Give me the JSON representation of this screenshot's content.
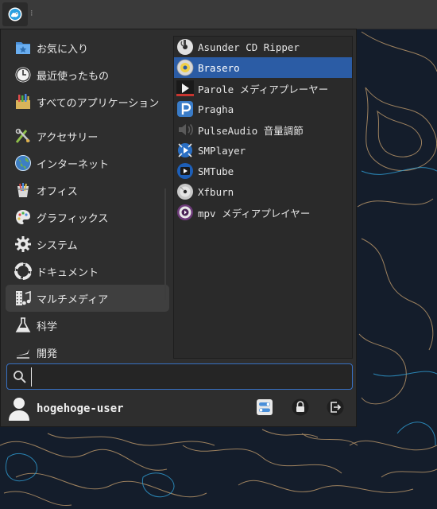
{
  "panel": {
    "menu_button_icon": "xfce-logo-icon",
    "separator": "⁝"
  },
  "categories": [
    {
      "label": "お気に入り",
      "icon": "favorites-icon"
    },
    {
      "label": "最近使ったもの",
      "icon": "clock-icon"
    },
    {
      "label": "すべてのアプリケーション",
      "icon": "all-applications-icon"
    },
    {
      "label": "アクセサリー",
      "icon": "accessories-icon"
    },
    {
      "label": "インターネット",
      "icon": "globe-icon"
    },
    {
      "label": "オフィス",
      "icon": "office-icon"
    },
    {
      "label": "グラフィックス",
      "icon": "palette-icon"
    },
    {
      "label": "システム",
      "icon": "gear-icon"
    },
    {
      "label": "ドキュメント",
      "icon": "lifebuoy-icon"
    },
    {
      "label": "マルチメディア",
      "icon": "multimedia-icon",
      "active": true
    },
    {
      "label": "科学",
      "icon": "flask-icon"
    },
    {
      "label": "開発",
      "icon": "development-icon"
    }
  ],
  "apps": [
    {
      "label": "Asunder CD Ripper",
      "icon": "cd-icon"
    },
    {
      "label": "Brasero",
      "icon": "disc-burner-icon",
      "selected": true
    },
    {
      "label": "Parole メディアプレーヤー",
      "icon": "media-player-icon"
    },
    {
      "label": "Pragha",
      "icon": "music-player-icon"
    },
    {
      "label": "PulseAudio 音量調節",
      "icon": "speaker-icon"
    },
    {
      "label": "SMPlayer",
      "icon": "smplayer-icon"
    },
    {
      "label": "SMTube",
      "icon": "smtube-icon"
    },
    {
      "label": "Xfburn",
      "icon": "disc-icon"
    },
    {
      "label": "mpv メディアプレイヤー",
      "icon": "mpv-icon"
    }
  ],
  "search": {
    "value": "",
    "placeholder": "",
    "icon": "search-icon"
  },
  "user": {
    "name": "hogehoge-user",
    "avatar_icon": "user-avatar-icon"
  },
  "actions": [
    {
      "name": "settings-toggle-icon"
    },
    {
      "name": "lock-icon"
    },
    {
      "name": "logout-icon"
    }
  ],
  "colors": {
    "selection": "#2b5ca5",
    "search_border": "#3770c3",
    "menu_bg": "#2e2e2e",
    "desktop_bg": "#141d2b"
  }
}
